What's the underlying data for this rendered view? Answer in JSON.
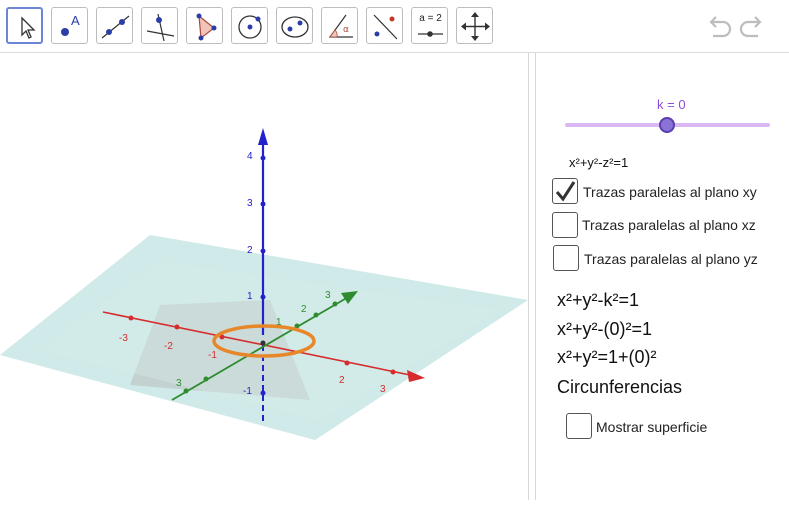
{
  "toolbar": {
    "tools": [
      {
        "name": "move-tool",
        "icon": "arrow-pointer-icon",
        "selected": true
      },
      {
        "name": "point-tool",
        "icon": "point-icon",
        "label": "A"
      },
      {
        "name": "line-tool",
        "icon": "line-icon"
      },
      {
        "name": "perpendicular-tool",
        "icon": "perpendicular-line-icon"
      },
      {
        "name": "polygon-tool",
        "icon": "polygon-icon"
      },
      {
        "name": "circle-tool",
        "icon": "circle-icon"
      },
      {
        "name": "conic-tool",
        "icon": "ellipse-icon"
      },
      {
        "name": "angle-tool",
        "icon": "angle-icon",
        "label": "α"
      },
      {
        "name": "reflect-tool",
        "icon": "reflect-icon"
      },
      {
        "name": "slider-tool",
        "icon": "slider-icon",
        "label": "a = 2"
      },
      {
        "name": "move-view-tool",
        "icon": "move-graphics-icon"
      }
    ],
    "undo_icon": "undo-icon",
    "redo_icon": "redo-icon"
  },
  "graphics": {
    "axis_ticks": {
      "z": [
        "4",
        "3",
        "2",
        "1",
        "-1"
      ],
      "x": [
        "-3",
        "-2",
        "-1",
        "2",
        "3"
      ],
      "y": [
        "3",
        "2",
        "1",
        "3"
      ]
    }
  },
  "panel": {
    "slider": {
      "label": "k = 0",
      "value": 0
    },
    "equation_small": "x²+y²-z²=1",
    "checkboxes": [
      {
        "label": "Trazas paralelas al plano xy",
        "checked": true
      },
      {
        "label": "Trazas paralelas al plano xz",
        "checked": false
      },
      {
        "label": "Trazas paralelas al plano yz",
        "checked": false
      }
    ],
    "equations": [
      "x²+y²-k²=1",
      "x²+y²-(0)²=1",
      "x²+y²=1+(0)²",
      "Circunferencias"
    ],
    "surface_checkbox": {
      "label": "Mostrar superficie",
      "checked": false
    }
  },
  "colors": {
    "x_axis": "#d62c2c",
    "y_axis": "#2e8b2e",
    "z_axis": "#2222cc",
    "trace": "#e8862a",
    "plane": "#bfe3e0",
    "slider_accent": "#8b4fd6",
    "selected_tool": "#6b86d6"
  }
}
